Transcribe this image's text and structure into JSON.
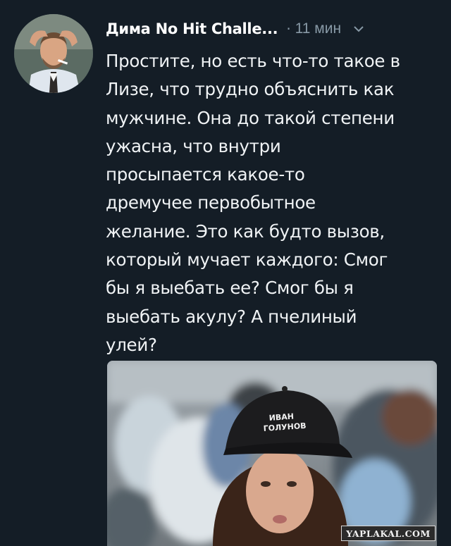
{
  "tweet": {
    "author_name": "Дима No Hit Challe...",
    "separator": "·",
    "timestamp": "11 мин",
    "menu_icon": "chevron-down-icon",
    "avatar_icon": "user-avatar",
    "text": "Простите, но есть что-то такое в\nЛизе, что трудно объяснить как\nмужчине. Она до такой степени\nужасна, что внутри\nпросыпается какое-то\nдремучее первобытное\nжелание. Это как будто вызов,\nкоторый мучает каждого: Смог\nбы я выебать ее? Смог бы я\nвыебать акулу? А пчелиный\nулей?",
    "media": {
      "cap_text_line1": "ИВАН",
      "cap_text_line2": "ГОЛУНОВ"
    }
  },
  "watermark": "YAPLAKAL.COM",
  "colors": {
    "background": "#141d26",
    "text": "#f0f3f5",
    "muted": "#8899a6"
  }
}
